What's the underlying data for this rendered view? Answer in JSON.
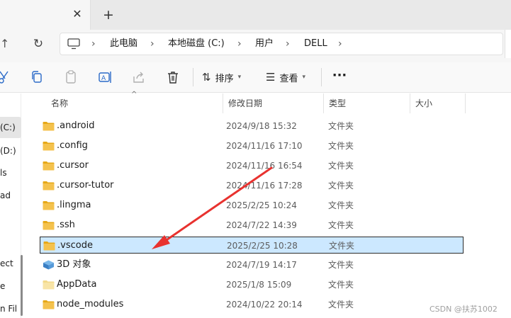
{
  "tabbar": {
    "close_label": "✕",
    "new_tab_label": "+"
  },
  "nav": {
    "up_icon": "↑",
    "refresh_icon": "↻"
  },
  "breadcrumb": {
    "items": [
      "此电脑",
      "本地磁盘 (C:)",
      "用户",
      "DELL"
    ],
    "separator": "›"
  },
  "commandbar": {
    "sort_label": "排序",
    "view_label": "查看",
    "more_label": "···"
  },
  "sidebar": {
    "items": [
      {
        "label": "(C:)",
        "selected": true
      },
      {
        "label": "(D:)",
        "selected": false
      },
      {
        "label": "ls",
        "selected": false
      },
      {
        "label": "ad",
        "selected": false
      },
      {
        "label": "ect",
        "selected": false
      },
      {
        "label": "e",
        "selected": false
      },
      {
        "label": "n Fil",
        "selected": false
      }
    ]
  },
  "columns": {
    "name": "名称",
    "modified": "修改日期",
    "type": "类型",
    "size": "大小"
  },
  "files": [
    {
      "name": ".android",
      "modified": "2024/9/18 15:32",
      "type": "文件夹",
      "icon": "folder-icon"
    },
    {
      "name": ".config",
      "modified": "2024/11/16 17:10",
      "type": "文件夹",
      "icon": "folder-icon"
    },
    {
      "name": ".cursor",
      "modified": "2024/11/16 16:54",
      "type": "文件夹",
      "icon": "folder-icon"
    },
    {
      "name": ".cursor-tutor",
      "modified": "2024/11/16 17:28",
      "type": "文件夹",
      "icon": "folder-icon"
    },
    {
      "name": ".lingma",
      "modified": "2025/2/25 10:24",
      "type": "文件夹",
      "icon": "folder-icon"
    },
    {
      "name": ".ssh",
      "modified": "2024/7/22 14:39",
      "type": "文件夹",
      "icon": "folder-icon"
    },
    {
      "name": ".vscode",
      "modified": "2025/2/25 10:28",
      "type": "文件夹",
      "icon": "folder-icon",
      "selected": true
    },
    {
      "name": "3D 对象",
      "modified": "2024/7/19 14:17",
      "type": "文件夹",
      "icon": "3d-objects-icon"
    },
    {
      "name": "AppData",
      "modified": "2025/1/8 15:09",
      "type": "文件夹",
      "icon": "folder-light-icon"
    },
    {
      "name": "node_modules",
      "modified": "2024/10/22 20:14",
      "type": "文件夹",
      "icon": "folder-icon"
    }
  ],
  "watermark": "CSDN @扶苏1002",
  "colors": {
    "folder": "#f4c24d",
    "folder_dark": "#e6a817",
    "selection": "#cce8ff",
    "arrow": "#e8322f",
    "accent": "#2a6ac8"
  }
}
